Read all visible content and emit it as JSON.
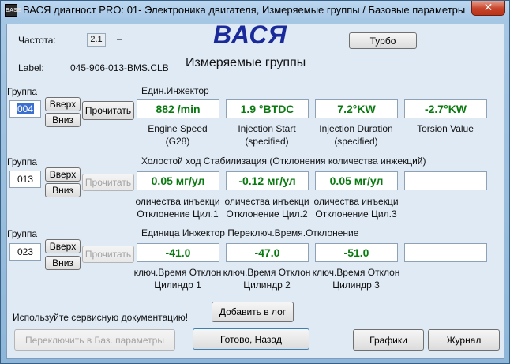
{
  "window": {
    "title": "ВАСЯ диагност PRO: 01- Электроника двигателя,  Измеряемые группы / Базовые параметры",
    "icon_text": "BASE",
    "close_glyph": "✕"
  },
  "header": {
    "freq_label": "Частота:",
    "freq_value": "2.1",
    "freq_dash": "–",
    "logo": "ВАСЯ",
    "turbo_label": "Турбо",
    "label_caption": "Label:",
    "label_value": "045-906-013-BMS.CLB",
    "section_title": "Измеряемые группы"
  },
  "groups": [
    {
      "group_label": "Группа",
      "number": "004",
      "title": "Един.Инжектор",
      "up": "Вверх",
      "down": "Вниз",
      "read": "Прочитать",
      "values": [
        "882 /min",
        "1.9 °BTDC",
        "7.2°KW",
        "-2.7°KW"
      ],
      "captions": [
        [
          "Engine Speed",
          "(G28)"
        ],
        [
          "Injection Start",
          "(specified)"
        ],
        [
          "Injection Duration",
          "(specified)"
        ],
        [
          "Torsion Value",
          ""
        ]
      ]
    },
    {
      "group_label": "Группа",
      "number": "013",
      "title": "Холостой ход Стабилизация (Отклонения количества инжекций)",
      "up": "Вверх",
      "down": "Вниз",
      "read": "Прочитать",
      "values": [
        "0.05 мг/ул",
        "-0.12 мг/ул",
        "0.05 мг/ул",
        ""
      ],
      "captions": [
        [
          "оличества инъекци",
          "Отклонение Цил.1"
        ],
        [
          "оличества инъекци",
          "Отклонение Цил.2"
        ],
        [
          "оличества инъекци",
          "Отклонение Цил.3"
        ],
        [
          "",
          ""
        ]
      ]
    },
    {
      "group_label": "Группа",
      "number": "023",
      "title": "Единица Инжектор Переключ.Время.Отклонение",
      "up": "Вверх",
      "down": "Вниз",
      "read": "Прочитать",
      "values": [
        "-41.0",
        "-47.0",
        "-51.0",
        ""
      ],
      "captions": [
        [
          "ключ.Время Отклон",
          "Цилиндр 1"
        ],
        [
          "ключ.Время Отклон",
          "Цилиндр 2"
        ],
        [
          "ключ.Время Отклон",
          "Цилиндр 3"
        ],
        [
          "",
          ""
        ]
      ]
    }
  ],
  "footer": {
    "hint": "Используйте сервисную документацию!",
    "add_log": "Добавить в лог",
    "switch_basic": "Переключить в Баз. параметры",
    "done_back": "Готово, Назад",
    "graphs": "Графики",
    "journal": "Журнал"
  },
  "colors": {
    "value_text": "#0a7a10",
    "logo": "#1b2a9a"
  }
}
